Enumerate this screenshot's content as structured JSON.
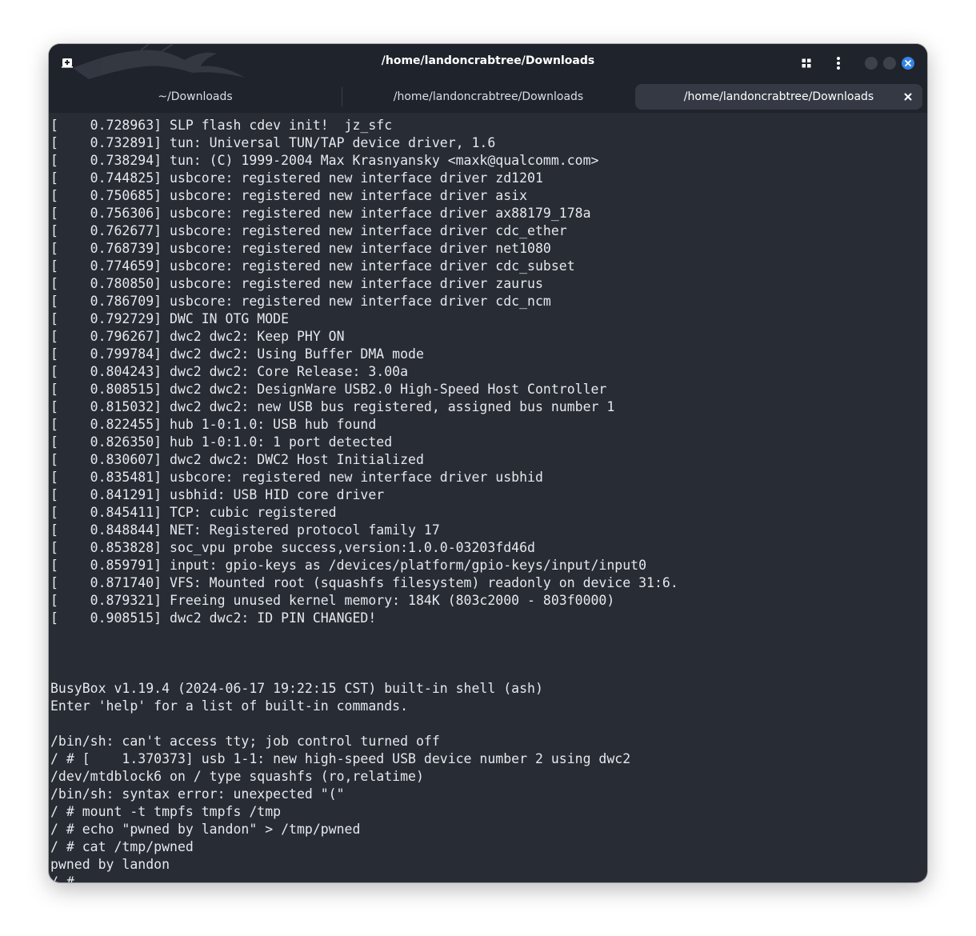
{
  "window": {
    "title": "/home/landoncrabtree/Downloads"
  },
  "tabs": [
    {
      "label": "~/Downloads",
      "active": false
    },
    {
      "label": "/home/landoncrabtree/Downloads",
      "active": false
    },
    {
      "label": "/home/landoncrabtree/Downloads",
      "active": true
    }
  ],
  "icons": {
    "new_tab": "new-tab-icon",
    "grid": "grid-icon",
    "menu": "kebab-menu-icon",
    "minimize": "minimize-icon",
    "maximize": "maximize-icon",
    "close": "close-icon",
    "tab_close": "close-icon"
  },
  "colors": {
    "window_bg": "#272c35",
    "titlebar_bg": "#1f232b",
    "active_tab_bg": "#343944",
    "text": "#e6e8ec",
    "close_accent": "#3584e4"
  },
  "terminal": {
    "lines": [
      "[    0.728963] SLP flash cdev init!  jz_sfc",
      "[    0.732891] tun: Universal TUN/TAP device driver, 1.6",
      "[    0.738294] tun: (C) 1999-2004 Max Krasnyansky <maxk@qualcomm.com>",
      "[    0.744825] usbcore: registered new interface driver zd1201",
      "[    0.750685] usbcore: registered new interface driver asix",
      "[    0.756306] usbcore: registered new interface driver ax88179_178a",
      "[    0.762677] usbcore: registered new interface driver cdc_ether",
      "[    0.768739] usbcore: registered new interface driver net1080",
      "[    0.774659] usbcore: registered new interface driver cdc_subset",
      "[    0.780850] usbcore: registered new interface driver zaurus",
      "[    0.786709] usbcore: registered new interface driver cdc_ncm",
      "[    0.792729] DWC IN OTG MODE",
      "[    0.796267] dwc2 dwc2: Keep PHY ON",
      "[    0.799784] dwc2 dwc2: Using Buffer DMA mode",
      "[    0.804243] dwc2 dwc2: Core Release: 3.00a",
      "[    0.808515] dwc2 dwc2: DesignWare USB2.0 High-Speed Host Controller",
      "[    0.815032] dwc2 dwc2: new USB bus registered, assigned bus number 1",
      "[    0.822455] hub 1-0:1.0: USB hub found",
      "[    0.826350] hub 1-0:1.0: 1 port detected",
      "[    0.830607] dwc2 dwc2: DWC2 Host Initialized",
      "[    0.835481] usbcore: registered new interface driver usbhid",
      "[    0.841291] usbhid: USB HID core driver",
      "[    0.845411] TCP: cubic registered",
      "[    0.848844] NET: Registered protocol family 17",
      "[    0.853828] soc_vpu probe success,version:1.0.0-03203fd46d",
      "[    0.859791] input: gpio-keys as /devices/platform/gpio-keys/input/input0",
      "[    0.871740] VFS: Mounted root (squashfs filesystem) readonly on device 31:6.",
      "[    0.879321] Freeing unused kernel memory: 184K (803c2000 - 803f0000)",
      "[    0.908515] dwc2 dwc2: ID PIN CHANGED!",
      "",
      "",
      "",
      "BusyBox v1.19.4 (2024-06-17 19:22:15 CST) built-in shell (ash)",
      "Enter 'help' for a list of built-in commands.",
      "",
      "/bin/sh: can't access tty; job control turned off",
      "/ # [    1.370373] usb 1-1: new high-speed USB device number 2 using dwc2",
      "/dev/mtdblock6 on / type squashfs (ro,relatime)",
      "/bin/sh: syntax error: unexpected \"(\"",
      "/ # mount -t tmpfs tmpfs /tmp",
      "/ # echo \"pwned by landon\" > /tmp/pwned",
      "/ # cat /tmp/pwned",
      "pwned by landon",
      "/ #"
    ]
  }
}
